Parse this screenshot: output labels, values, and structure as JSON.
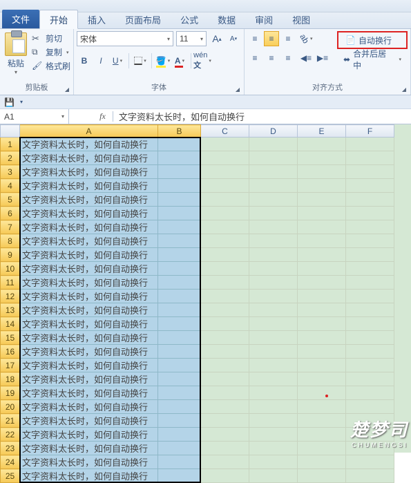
{
  "tabs": {
    "file": "文件",
    "home": "开始",
    "insert": "插入",
    "layout": "页面布局",
    "formulas": "公式",
    "data": "数据",
    "review": "审阅",
    "view": "视图"
  },
  "clipboard": {
    "paste": "粘贴",
    "cut": "剪切",
    "copy": "复制",
    "format_painter": "格式刷",
    "group": "剪贴板"
  },
  "font": {
    "name": "宋体",
    "size": "11",
    "bold": "B",
    "italic": "I",
    "underline": "U",
    "grow": "A",
    "shrink": "A",
    "group": "字体"
  },
  "alignment": {
    "wrap_text": "自动换行",
    "merge_center": "合并后居中",
    "group": "对齐方式"
  },
  "formula_bar": {
    "cell_ref": "A1",
    "fx": "fx",
    "content": "文字资料太长时，如何自动换行"
  },
  "columns": [
    "A",
    "B",
    "C",
    "D",
    "E",
    "F"
  ],
  "cell_text": "文字资料太长时，如何自动换行",
  "row_count": 25,
  "watermark": {
    "main": "楚梦司",
    "sub": "CHUMENGSI"
  }
}
